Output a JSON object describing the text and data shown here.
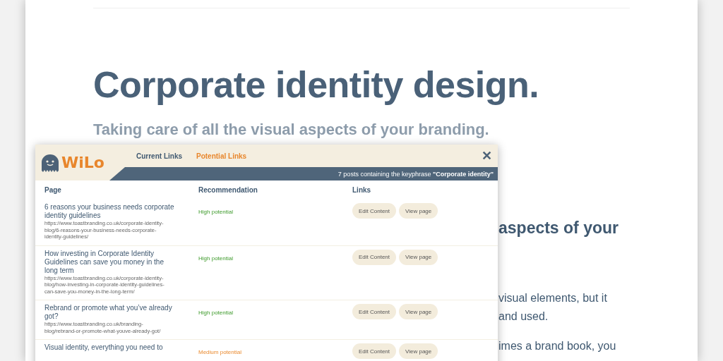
{
  "page": {
    "heading": "Corporate identity design.",
    "subheading": "Taking care of all the visual aspects of your branding.",
    "behind_fragments": [
      {
        "kind": "heading",
        "text": "aspects of your"
      },
      {
        "kind": "body",
        "text": "visual elements, but it"
      },
      {
        "kind": "body",
        "text": "and used."
      },
      {
        "kind": "gap",
        "text": "imes a brand book, you"
      }
    ]
  },
  "popup": {
    "logo": "WiLo",
    "tabs": [
      {
        "label": "Current Links",
        "selected": false
      },
      {
        "label": "Potential Links",
        "selected": true
      }
    ],
    "close": "✕",
    "banner": "7 posts containing the keyphrase **\"Corporate identity\"**",
    "columns": [
      "Page",
      "Recommendation",
      "Links"
    ],
    "rows": [
      {
        "title": "6 reasons your business needs corporate identity guidelines",
        "url": "https://www.toastbranding.co.uk/corporate-identity-blog/6-reasons-your-business-needs-corporate-identity-guidelines/",
        "recommendation": "High potential",
        "kind": "high",
        "buttons": [
          "Edit Content",
          "View page"
        ]
      },
      {
        "title": "How investing in Corporate Identity Guidelines can save you money in the long term",
        "url": "https://www.toastbranding.co.uk/corporate-identity-blog/how-investing-in-corporate-identity-guidelines-can-save-you-money-in-the-long-term/",
        "recommendation": "High potential",
        "kind": "high",
        "buttons": [
          "Edit Content",
          "View page"
        ]
      },
      {
        "title": "Rebrand or promote what you’ve already got?",
        "url": "https://www.toastbranding.co.uk/branding-blog/rebrand-or-promote-what-youve-already-got/",
        "recommendation": "High potential",
        "kind": "high",
        "buttons": [
          "Edit Content",
          "View page"
        ]
      },
      {
        "title": "Visual identity, everything you need to",
        "recommendation": "Medium potential",
        "kind": "medium",
        "buttons": [
          "Edit Content",
          "View page"
        ]
      }
    ]
  }
}
